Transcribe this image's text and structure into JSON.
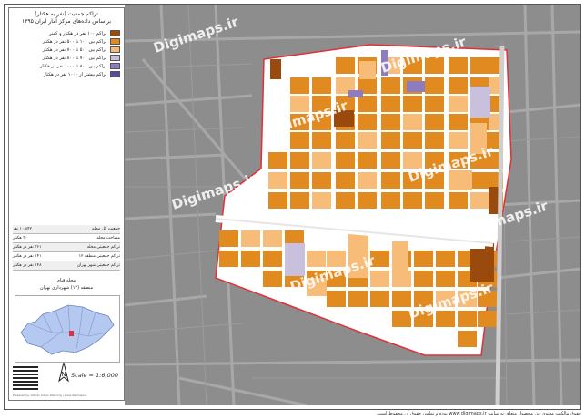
{
  "legend": {
    "title_line1": "تراکم جمعیت (نفر به هکتار)",
    "title_line2": "براساس داده‌های مرکز آمار ایران ۱۳۹۵",
    "classes": [
      {
        "label": "تراکم ۱۰۰ نفر در هکتار و کمتر",
        "color": "#9a4a0c"
      },
      {
        "label": "تراکم بین ۱۰۱ تا ۵۰۰ نفر در هکتار",
        "color": "#e08a1f"
      },
      {
        "label": "تراکم بین ۵۰۱ تا ۷۰۰ نفر در هکتار",
        "color": "#f6bc78"
      },
      {
        "label": "تراکم بین ۷۰۱ تا ۸۰۰ نفر در هکتار",
        "color": "#c8c0dc"
      },
      {
        "label": "تراکم بین ۸۰۱ تا ۱۰۰۰ نفر در هکتار",
        "color": "#8e7cc0"
      },
      {
        "label": "تراکم بیشتر از ۱۰۰۰ نفر در هکتار",
        "color": "#5b4b9e"
      }
    ],
    "stats": [
      {
        "label": "جمعیت کل محله",
        "value": "۱۰,۸۴۲ نفر"
      },
      {
        "label": "مساحت محله",
        "value": "۳۰ هکتار"
      },
      {
        "label": "تراکم جمعیتی محله",
        "value": "۳۶۱ نفر در هکتار"
      },
      {
        "label": "تراکم جمعیتی منطقه ۱۲",
        "value": "۱۴۱ نفر در هکتار"
      },
      {
        "label": "تراکم جمعیتی شهر تهران",
        "value": "۱۴۸ نفر در هکتار"
      }
    ],
    "area_line1": "محله قیام",
    "area_line2": "منطقه (۱۲) شهرداری تهران",
    "scale": "Scale = 1:6,000",
    "copyright": "Prepared by: Tehran Urban Planning | www.digimaps.ir"
  },
  "watermark": "Digimaps.ir",
  "footer": "حقوق مالکیت معنوی این محصول متعلق به سایت www.digimaps.ir بوده و تمامی حقوق آن محفوظ است.",
  "colors": {
    "map_bg": "#8d8d8d",
    "block_main": "#e08a1f",
    "block_light": "#f6bc78",
    "block_dark": "#9a4a0c",
    "block_purple": "#8e7cc0",
    "block_lavender": "#c8c0dc",
    "boundary": "#e0303a"
  }
}
